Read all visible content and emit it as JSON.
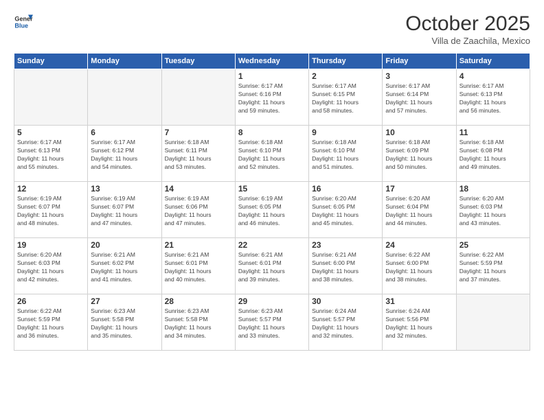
{
  "header": {
    "logo_general": "General",
    "logo_blue": "Blue",
    "month_title": "October 2025",
    "subtitle": "Villa de Zaachila, Mexico"
  },
  "weekdays": [
    "Sunday",
    "Monday",
    "Tuesday",
    "Wednesday",
    "Thursday",
    "Friday",
    "Saturday"
  ],
  "weeks": [
    [
      {
        "day": "",
        "empty": true
      },
      {
        "day": "",
        "empty": true
      },
      {
        "day": "",
        "empty": true
      },
      {
        "day": "1",
        "info": "Sunrise: 6:17 AM\nSunset: 6:16 PM\nDaylight: 11 hours\nand 59 minutes."
      },
      {
        "day": "2",
        "info": "Sunrise: 6:17 AM\nSunset: 6:15 PM\nDaylight: 11 hours\nand 58 minutes."
      },
      {
        "day": "3",
        "info": "Sunrise: 6:17 AM\nSunset: 6:14 PM\nDaylight: 11 hours\nand 57 minutes."
      },
      {
        "day": "4",
        "info": "Sunrise: 6:17 AM\nSunset: 6:13 PM\nDaylight: 11 hours\nand 56 minutes."
      }
    ],
    [
      {
        "day": "5",
        "info": "Sunrise: 6:17 AM\nSunset: 6:13 PM\nDaylight: 11 hours\nand 55 minutes."
      },
      {
        "day": "6",
        "info": "Sunrise: 6:17 AM\nSunset: 6:12 PM\nDaylight: 11 hours\nand 54 minutes."
      },
      {
        "day": "7",
        "info": "Sunrise: 6:18 AM\nSunset: 6:11 PM\nDaylight: 11 hours\nand 53 minutes."
      },
      {
        "day": "8",
        "info": "Sunrise: 6:18 AM\nSunset: 6:10 PM\nDaylight: 11 hours\nand 52 minutes."
      },
      {
        "day": "9",
        "info": "Sunrise: 6:18 AM\nSunset: 6:10 PM\nDaylight: 11 hours\nand 51 minutes."
      },
      {
        "day": "10",
        "info": "Sunrise: 6:18 AM\nSunset: 6:09 PM\nDaylight: 11 hours\nand 50 minutes."
      },
      {
        "day": "11",
        "info": "Sunrise: 6:18 AM\nSunset: 6:08 PM\nDaylight: 11 hours\nand 49 minutes."
      }
    ],
    [
      {
        "day": "12",
        "info": "Sunrise: 6:19 AM\nSunset: 6:07 PM\nDaylight: 11 hours\nand 48 minutes."
      },
      {
        "day": "13",
        "info": "Sunrise: 6:19 AM\nSunset: 6:07 PM\nDaylight: 11 hours\nand 47 minutes."
      },
      {
        "day": "14",
        "info": "Sunrise: 6:19 AM\nSunset: 6:06 PM\nDaylight: 11 hours\nand 47 minutes."
      },
      {
        "day": "15",
        "info": "Sunrise: 6:19 AM\nSunset: 6:05 PM\nDaylight: 11 hours\nand 46 minutes."
      },
      {
        "day": "16",
        "info": "Sunrise: 6:20 AM\nSunset: 6:05 PM\nDaylight: 11 hours\nand 45 minutes."
      },
      {
        "day": "17",
        "info": "Sunrise: 6:20 AM\nSunset: 6:04 PM\nDaylight: 11 hours\nand 44 minutes."
      },
      {
        "day": "18",
        "info": "Sunrise: 6:20 AM\nSunset: 6:03 PM\nDaylight: 11 hours\nand 43 minutes."
      }
    ],
    [
      {
        "day": "19",
        "info": "Sunrise: 6:20 AM\nSunset: 6:03 PM\nDaylight: 11 hours\nand 42 minutes."
      },
      {
        "day": "20",
        "info": "Sunrise: 6:21 AM\nSunset: 6:02 PM\nDaylight: 11 hours\nand 41 minutes."
      },
      {
        "day": "21",
        "info": "Sunrise: 6:21 AM\nSunset: 6:01 PM\nDaylight: 11 hours\nand 40 minutes."
      },
      {
        "day": "22",
        "info": "Sunrise: 6:21 AM\nSunset: 6:01 PM\nDaylight: 11 hours\nand 39 minutes."
      },
      {
        "day": "23",
        "info": "Sunrise: 6:21 AM\nSunset: 6:00 PM\nDaylight: 11 hours\nand 38 minutes."
      },
      {
        "day": "24",
        "info": "Sunrise: 6:22 AM\nSunset: 6:00 PM\nDaylight: 11 hours\nand 38 minutes."
      },
      {
        "day": "25",
        "info": "Sunrise: 6:22 AM\nSunset: 5:59 PM\nDaylight: 11 hours\nand 37 minutes."
      }
    ],
    [
      {
        "day": "26",
        "info": "Sunrise: 6:22 AM\nSunset: 5:59 PM\nDaylight: 11 hours\nand 36 minutes."
      },
      {
        "day": "27",
        "info": "Sunrise: 6:23 AM\nSunset: 5:58 PM\nDaylight: 11 hours\nand 35 minutes."
      },
      {
        "day": "28",
        "info": "Sunrise: 6:23 AM\nSunset: 5:58 PM\nDaylight: 11 hours\nand 34 minutes."
      },
      {
        "day": "29",
        "info": "Sunrise: 6:23 AM\nSunset: 5:57 PM\nDaylight: 11 hours\nand 33 minutes."
      },
      {
        "day": "30",
        "info": "Sunrise: 6:24 AM\nSunset: 5:57 PM\nDaylight: 11 hours\nand 32 minutes."
      },
      {
        "day": "31",
        "info": "Sunrise: 6:24 AM\nSunset: 5:56 PM\nDaylight: 11 hours\nand 32 minutes."
      },
      {
        "day": "",
        "empty": true
      }
    ]
  ]
}
